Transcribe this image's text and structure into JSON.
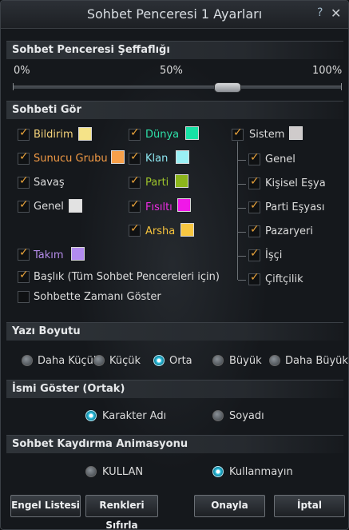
{
  "window": {
    "title": "Sohbet Penceresi 1 Ayarları",
    "help_icon": "?",
    "close_icon": "✕"
  },
  "transparency": {
    "header": "Sohbet Penceresi Şeffaflığı",
    "min": "0%",
    "mid": "50%",
    "max": "100%",
    "value_percent": 65
  },
  "chat_view": {
    "header": "Sohbeti Gör",
    "col1": [
      {
        "label": "Bildirim",
        "checked": true,
        "color": "#f5e388",
        "text_color": "#f5d37a"
      },
      {
        "label": "Sunucu Grubu",
        "checked": true,
        "color": "#f7a04a",
        "text_color": "#f29a45"
      },
      {
        "label": "Savaş",
        "checked": true,
        "color": null,
        "text_color": "#dcdcdc"
      },
      {
        "label": "Genel",
        "checked": true,
        "color": "#e2e2e2",
        "text_color": "#dcdcdc"
      },
      {
        "label": "Takım",
        "checked": true,
        "color": "#b28cef",
        "text_color": "#b48be8"
      }
    ],
    "col2": [
      {
        "label": "Dünya",
        "checked": true,
        "color": "#18e1a5",
        "text_color": "#2ee0a9"
      },
      {
        "label": "Klan",
        "checked": true,
        "color": "#9af0f5",
        "text_color": "#8ee8f2"
      },
      {
        "label": "Parti",
        "checked": true,
        "color": "#8cb51c",
        "text_color": "#9cc22b"
      },
      {
        "label": "Fısıltı",
        "checked": true,
        "color": "#f018e8",
        "text_color": "#ef2ce5"
      },
      {
        "label": "Arsha",
        "checked": true,
        "color": "#f7c640",
        "text_color": "#f5c23d"
      }
    ],
    "system": {
      "label": "Sistem",
      "checked": true,
      "color": "#cfcbcb"
    },
    "system_children": [
      {
        "label": "Genel",
        "checked": true
      },
      {
        "label": "Kişisel Eşya",
        "checked": true
      },
      {
        "label": "Parti Eşyası",
        "checked": true
      },
      {
        "label": "Pazaryeri",
        "checked": true
      },
      {
        "label": "İşçi",
        "checked": true
      },
      {
        "label": "Çiftçilik",
        "checked": true
      }
    ],
    "title_option": {
      "label": "Başlık (Tüm Sohbet Pencereleri için)",
      "checked": true
    },
    "time_option": {
      "label": "Sohbette Zamanı Göster",
      "checked": false
    }
  },
  "font_size": {
    "header": "Yazı Boyutu",
    "options": [
      "Daha Küçük",
      "Küçük",
      "Orta",
      "Büyük",
      "Daha Büyük"
    ],
    "selected": "Orta"
  },
  "show_name": {
    "header": "İsmi Göster (Ortak)",
    "options": [
      "Karakter Adı",
      "Soyadı"
    ],
    "selected": "Karakter Adı"
  },
  "scroll_anim": {
    "header": "Sohbet Kaydırma Animasyonu",
    "options": [
      "KULLAN",
      "Kullanmayın"
    ],
    "selected": "Kullanmayın"
  },
  "buttons": {
    "block_list": "Engel Listesi",
    "reset_colors": "Renkleri Sıfırla",
    "confirm": "Onayla",
    "cancel": "İptal"
  }
}
